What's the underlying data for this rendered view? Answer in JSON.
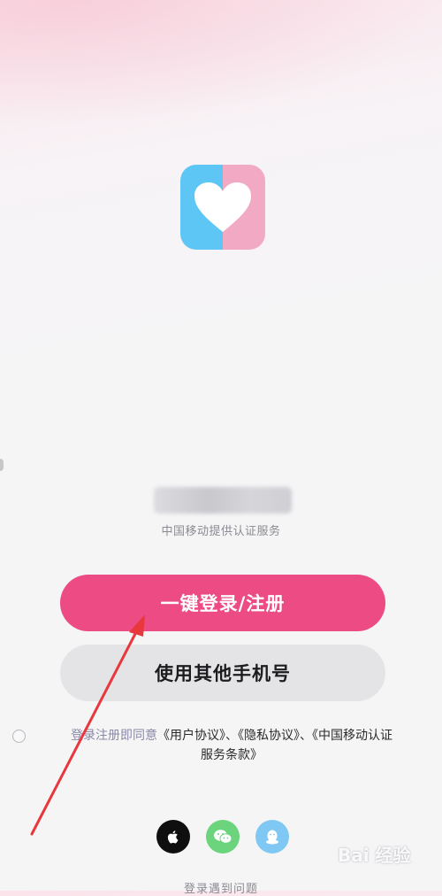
{
  "logo": {
    "icon": "heart-icon",
    "left_color": "#5ec6f5",
    "right_color": "#f2a9c4"
  },
  "phone": {
    "masked_number": "",
    "carrier_note": "中国移动提供认证服务"
  },
  "buttons": {
    "one_click_login": "一键登录/注册",
    "other_phone": "使用其他手机号"
  },
  "agreement": {
    "prefix": "登录注册即同意",
    "user_agreement": "《用户协议》",
    "sep1": "、",
    "privacy_agreement": "《隐私协议》",
    "sep2": "、",
    "carrier_terms_line1": "《中国移动认证",
    "carrier_terms_line2": "服务条款》"
  },
  "social_login": [
    {
      "icon": "apple-icon"
    },
    {
      "icon": "wechat-icon"
    },
    {
      "icon": "qq-icon"
    }
  ],
  "help_link": "登录遇到问题",
  "colors": {
    "primary": "#ec4b83",
    "secondary": "#e4e4e7",
    "annotation_arrow": "#e8383d"
  },
  "watermark": "Bai 经验"
}
